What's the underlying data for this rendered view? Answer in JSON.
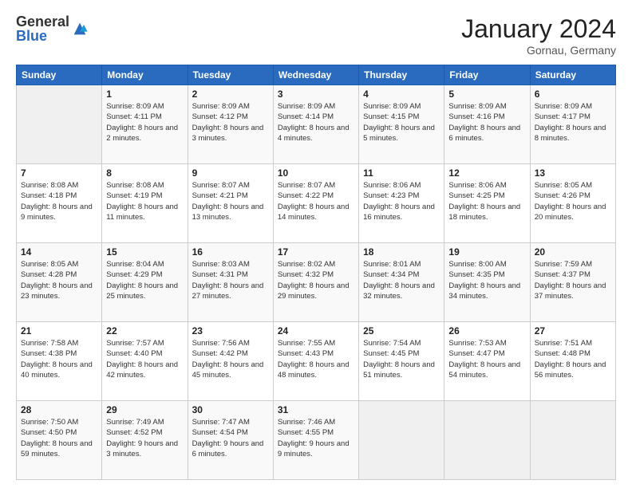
{
  "logo": {
    "general": "General",
    "blue": "Blue"
  },
  "header": {
    "month_year": "January 2024",
    "location": "Gornau, Germany"
  },
  "weekdays": [
    "Sunday",
    "Monday",
    "Tuesday",
    "Wednesday",
    "Thursday",
    "Friday",
    "Saturday"
  ],
  "weeks": [
    [
      {
        "day": "",
        "sunrise": "",
        "sunset": "",
        "daylight": ""
      },
      {
        "day": "1",
        "sunrise": "Sunrise: 8:09 AM",
        "sunset": "Sunset: 4:11 PM",
        "daylight": "Daylight: 8 hours and 2 minutes."
      },
      {
        "day": "2",
        "sunrise": "Sunrise: 8:09 AM",
        "sunset": "Sunset: 4:12 PM",
        "daylight": "Daylight: 8 hours and 3 minutes."
      },
      {
        "day": "3",
        "sunrise": "Sunrise: 8:09 AM",
        "sunset": "Sunset: 4:14 PM",
        "daylight": "Daylight: 8 hours and 4 minutes."
      },
      {
        "day": "4",
        "sunrise": "Sunrise: 8:09 AM",
        "sunset": "Sunset: 4:15 PM",
        "daylight": "Daylight: 8 hours and 5 minutes."
      },
      {
        "day": "5",
        "sunrise": "Sunrise: 8:09 AM",
        "sunset": "Sunset: 4:16 PM",
        "daylight": "Daylight: 8 hours and 6 minutes."
      },
      {
        "day": "6",
        "sunrise": "Sunrise: 8:09 AM",
        "sunset": "Sunset: 4:17 PM",
        "daylight": "Daylight: 8 hours and 8 minutes."
      }
    ],
    [
      {
        "day": "7",
        "sunrise": "Sunrise: 8:08 AM",
        "sunset": "Sunset: 4:18 PM",
        "daylight": "Daylight: 8 hours and 9 minutes."
      },
      {
        "day": "8",
        "sunrise": "Sunrise: 8:08 AM",
        "sunset": "Sunset: 4:19 PM",
        "daylight": "Daylight: 8 hours and 11 minutes."
      },
      {
        "day": "9",
        "sunrise": "Sunrise: 8:07 AM",
        "sunset": "Sunset: 4:21 PM",
        "daylight": "Daylight: 8 hours and 13 minutes."
      },
      {
        "day": "10",
        "sunrise": "Sunrise: 8:07 AM",
        "sunset": "Sunset: 4:22 PM",
        "daylight": "Daylight: 8 hours and 14 minutes."
      },
      {
        "day": "11",
        "sunrise": "Sunrise: 8:06 AM",
        "sunset": "Sunset: 4:23 PM",
        "daylight": "Daylight: 8 hours and 16 minutes."
      },
      {
        "day": "12",
        "sunrise": "Sunrise: 8:06 AM",
        "sunset": "Sunset: 4:25 PM",
        "daylight": "Daylight: 8 hours and 18 minutes."
      },
      {
        "day": "13",
        "sunrise": "Sunrise: 8:05 AM",
        "sunset": "Sunset: 4:26 PM",
        "daylight": "Daylight: 8 hours and 20 minutes."
      }
    ],
    [
      {
        "day": "14",
        "sunrise": "Sunrise: 8:05 AM",
        "sunset": "Sunset: 4:28 PM",
        "daylight": "Daylight: 8 hours and 23 minutes."
      },
      {
        "day": "15",
        "sunrise": "Sunrise: 8:04 AM",
        "sunset": "Sunset: 4:29 PM",
        "daylight": "Daylight: 8 hours and 25 minutes."
      },
      {
        "day": "16",
        "sunrise": "Sunrise: 8:03 AM",
        "sunset": "Sunset: 4:31 PM",
        "daylight": "Daylight: 8 hours and 27 minutes."
      },
      {
        "day": "17",
        "sunrise": "Sunrise: 8:02 AM",
        "sunset": "Sunset: 4:32 PM",
        "daylight": "Daylight: 8 hours and 29 minutes."
      },
      {
        "day": "18",
        "sunrise": "Sunrise: 8:01 AM",
        "sunset": "Sunset: 4:34 PM",
        "daylight": "Daylight: 8 hours and 32 minutes."
      },
      {
        "day": "19",
        "sunrise": "Sunrise: 8:00 AM",
        "sunset": "Sunset: 4:35 PM",
        "daylight": "Daylight: 8 hours and 34 minutes."
      },
      {
        "day": "20",
        "sunrise": "Sunrise: 7:59 AM",
        "sunset": "Sunset: 4:37 PM",
        "daylight": "Daylight: 8 hours and 37 minutes."
      }
    ],
    [
      {
        "day": "21",
        "sunrise": "Sunrise: 7:58 AM",
        "sunset": "Sunset: 4:38 PM",
        "daylight": "Daylight: 8 hours and 40 minutes."
      },
      {
        "day": "22",
        "sunrise": "Sunrise: 7:57 AM",
        "sunset": "Sunset: 4:40 PM",
        "daylight": "Daylight: 8 hours and 42 minutes."
      },
      {
        "day": "23",
        "sunrise": "Sunrise: 7:56 AM",
        "sunset": "Sunset: 4:42 PM",
        "daylight": "Daylight: 8 hours and 45 minutes."
      },
      {
        "day": "24",
        "sunrise": "Sunrise: 7:55 AM",
        "sunset": "Sunset: 4:43 PM",
        "daylight": "Daylight: 8 hours and 48 minutes."
      },
      {
        "day": "25",
        "sunrise": "Sunrise: 7:54 AM",
        "sunset": "Sunset: 4:45 PM",
        "daylight": "Daylight: 8 hours and 51 minutes."
      },
      {
        "day": "26",
        "sunrise": "Sunrise: 7:53 AM",
        "sunset": "Sunset: 4:47 PM",
        "daylight": "Daylight: 8 hours and 54 minutes."
      },
      {
        "day": "27",
        "sunrise": "Sunrise: 7:51 AM",
        "sunset": "Sunset: 4:48 PM",
        "daylight": "Daylight: 8 hours and 56 minutes."
      }
    ],
    [
      {
        "day": "28",
        "sunrise": "Sunrise: 7:50 AM",
        "sunset": "Sunset: 4:50 PM",
        "daylight": "Daylight: 8 hours and 59 minutes."
      },
      {
        "day": "29",
        "sunrise": "Sunrise: 7:49 AM",
        "sunset": "Sunset: 4:52 PM",
        "daylight": "Daylight: 9 hours and 3 minutes."
      },
      {
        "day": "30",
        "sunrise": "Sunrise: 7:47 AM",
        "sunset": "Sunset: 4:54 PM",
        "daylight": "Daylight: 9 hours and 6 minutes."
      },
      {
        "day": "31",
        "sunrise": "Sunrise: 7:46 AM",
        "sunset": "Sunset: 4:55 PM",
        "daylight": "Daylight: 9 hours and 9 minutes."
      },
      {
        "day": "",
        "sunrise": "",
        "sunset": "",
        "daylight": ""
      },
      {
        "day": "",
        "sunrise": "",
        "sunset": "",
        "daylight": ""
      },
      {
        "day": "",
        "sunrise": "",
        "sunset": "",
        "daylight": ""
      }
    ]
  ]
}
